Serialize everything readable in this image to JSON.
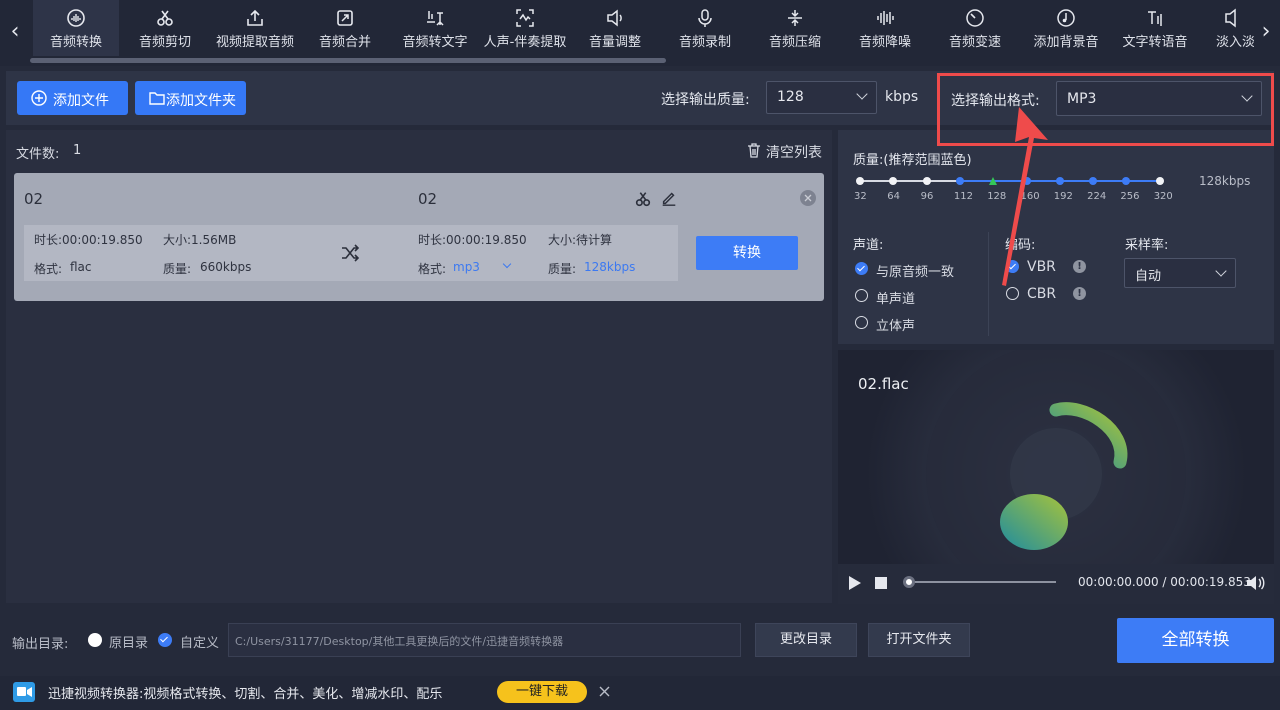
{
  "toolbar": {
    "items": [
      {
        "label": "音频转换",
        "icon": "audio-convert-icon"
      },
      {
        "label": "音频剪切",
        "icon": "scissors-icon"
      },
      {
        "label": "视频提取音频",
        "icon": "upload-icon"
      },
      {
        "label": "音频合并",
        "icon": "merge-icon"
      },
      {
        "label": "音频转文字",
        "icon": "speech-to-text-icon"
      },
      {
        "label": "人声-伴奏提取",
        "icon": "vocal-extract-icon"
      },
      {
        "label": "音量调整",
        "icon": "volume-icon"
      },
      {
        "label": "音频录制",
        "icon": "microphone-icon"
      },
      {
        "label": "音频压缩",
        "icon": "compress-icon"
      },
      {
        "label": "音频降噪",
        "icon": "denoise-icon"
      },
      {
        "label": "音频变速",
        "icon": "speed-icon"
      },
      {
        "label": "添加背景音",
        "icon": "background-music-icon"
      },
      {
        "label": "文字转语音",
        "icon": "text-to-speech-icon"
      },
      {
        "label": "淡入淡",
        "icon": "fade-icon"
      }
    ]
  },
  "actions": {
    "add_file": "添加文件",
    "add_folder": "添加文件夹",
    "quality_label": "选择输出质量:",
    "quality_value": "128",
    "quality_unit": "kbps",
    "format_label": "选择输出格式:",
    "format_value": "MP3"
  },
  "list": {
    "file_count_label": "文件数:",
    "file_count": "1",
    "clear_label": "清空列表"
  },
  "file": {
    "src_name": "02",
    "dst_name": "02",
    "src_duration": "时长:00:00:19.850",
    "src_size": "大小:1.56MB",
    "src_format_label": "格式:",
    "src_format": "flac",
    "src_quality_label": "质量:",
    "src_quality": "660kbps",
    "dst_duration": "时长:00:00:19.850",
    "dst_size": "大小:待计算",
    "dst_format_label": "格式:",
    "dst_format": "mp3",
    "dst_quality_label": "质量:",
    "dst_quality": "128kbps",
    "convert": "转换"
  },
  "quality": {
    "title": "质量:(推荐范围蓝色)",
    "ticks": [
      "32",
      "64",
      "96",
      "112",
      "128",
      "160",
      "192",
      "224",
      "256",
      "320"
    ],
    "current": "128kbps"
  },
  "audio": {
    "channel_label": "声道:",
    "channels": [
      "与原音频一致",
      "单声道",
      "立体声"
    ],
    "codec_label": "编码:",
    "codecs": [
      "VBR",
      "CBR"
    ],
    "samplerate_label": "采样率:",
    "samplerate_value": "自动"
  },
  "player": {
    "filename": "02.flac",
    "time": "00:00:00.000 / 00:00:19.853"
  },
  "output": {
    "label": "输出目录:",
    "opt_original": "原目录",
    "opt_custom": "自定义",
    "path": "C:/Users/31177/Desktop/其他工具更换后的文件/迅捷音频转换器",
    "change_dir": "更改目录",
    "open_folder": "打开文件夹",
    "convert_all": "全部转换"
  },
  "ad": {
    "text": "迅捷视频转换器:视频格式转换、切割、合并、美化、增减水印、配乐",
    "download": "一键下载"
  },
  "colors": {
    "accent": "#3d7cf6",
    "highlight_border": "#ef4b4b",
    "download": "#f6c21c"
  }
}
